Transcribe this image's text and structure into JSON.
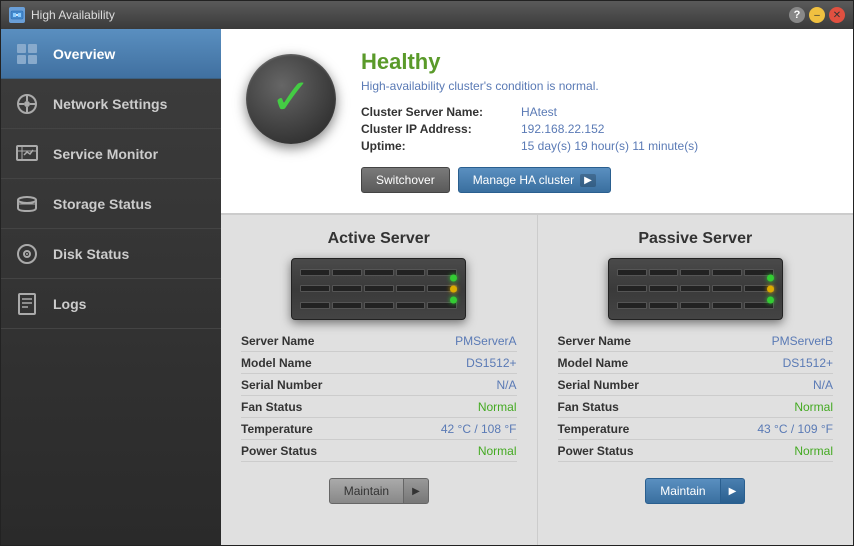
{
  "window": {
    "title": "High Availability"
  },
  "sidebar": {
    "items": [
      {
        "id": "overview",
        "label": "Overview",
        "active": true
      },
      {
        "id": "network-settings",
        "label": "Network Settings",
        "active": false
      },
      {
        "id": "service-monitor",
        "label": "Service Monitor",
        "active": false
      },
      {
        "id": "storage-status",
        "label": "Storage Status",
        "active": false
      },
      {
        "id": "disk-status",
        "label": "Disk Status",
        "active": false
      },
      {
        "id": "logs",
        "label": "Logs",
        "active": false
      }
    ]
  },
  "status": {
    "health": "Healthy",
    "description": "High-availability cluster's condition is normal.",
    "cluster_name_label": "Cluster Server Name:",
    "cluster_name_value": "HAtest",
    "cluster_ip_label": "Cluster IP Address:",
    "cluster_ip_value": "192.168.22.152",
    "uptime_label": "Uptime:",
    "uptime_value": "15 day(s) 19 hour(s) 11 minute(s)",
    "btn_switchover": "Switchover",
    "btn_manage": "Manage HA cluster"
  },
  "active_server": {
    "title": "Active Server",
    "name_label": "Server Name",
    "name_value": "PMServerA",
    "model_label": "Model Name",
    "model_value": "DS1512+",
    "serial_label": "Serial Number",
    "serial_value": "N/A",
    "fan_label": "Fan Status",
    "fan_value": "Normal",
    "temp_label": "Temperature",
    "temp_value": "42 °C / 108 °F",
    "power_label": "Power Status",
    "power_value": "Normal",
    "btn_maintain": "Maintain"
  },
  "passive_server": {
    "title": "Passive Server",
    "name_label": "Server Name",
    "name_value": "PMServerB",
    "model_label": "Model Name",
    "model_value": "DS1512+",
    "serial_label": "Serial Number",
    "serial_value": "N/A",
    "fan_label": "Fan Status",
    "fan_value": "Normal",
    "temp_label": "Temperature",
    "temp_value": "43 °C / 109 °F",
    "power_label": "Power Status",
    "power_value": "Normal",
    "btn_maintain": "Maintain"
  }
}
